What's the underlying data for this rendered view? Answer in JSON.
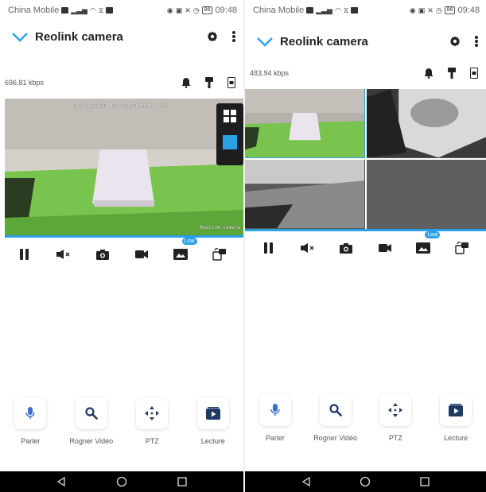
{
  "colors": {
    "accent": "#2aa1e6",
    "navbar": "#000000",
    "video_bg": "#444444"
  },
  "left": {
    "status": {
      "carrier": "China Mobile",
      "battery": "86",
      "time": "09:48"
    },
    "appbar": {
      "back_icon": "chevron-down-icon",
      "title": "Reolink camera",
      "settings_icon": "gear-icon",
      "more_icon": "more-vertical-icon"
    },
    "bitrate": "696,81 kbps",
    "video": {
      "timestamp": "05/11/2020 15:40:50 mar. lun",
      "cam_label": "Reolink camera",
      "layout_icons": [
        "grid-4-icon",
        "single-view-icon"
      ]
    },
    "controls": {
      "low_badge": "Low"
    },
    "actions": [
      {
        "label": "Parler",
        "icon": "microphone-icon"
      },
      {
        "label": "Rogner Vidéo",
        "icon": "search-icon"
      },
      {
        "label": "PTZ",
        "icon": "ptz-arrows-icon"
      },
      {
        "label": "Lecture",
        "icon": "playback-icon"
      }
    ]
  },
  "right": {
    "status": {
      "carrier": "China Mobile",
      "battery": "86",
      "time": "09:48"
    },
    "appbar": {
      "back_icon": "chevron-down-icon",
      "title": "Reolink camera",
      "settings_icon": "gear-icon",
      "more_icon": "more-vertical-icon"
    },
    "bitrate": "483,94 kbps",
    "controls": {
      "low_badge": "Low"
    },
    "actions": [
      {
        "label": "Parler",
        "icon": "microphone-icon"
      },
      {
        "label": "Rogner Vidéo",
        "icon": "search-icon"
      },
      {
        "label": "PTZ",
        "icon": "ptz-arrows-icon"
      },
      {
        "label": "Lecture",
        "icon": "playback-icon"
      }
    ]
  }
}
